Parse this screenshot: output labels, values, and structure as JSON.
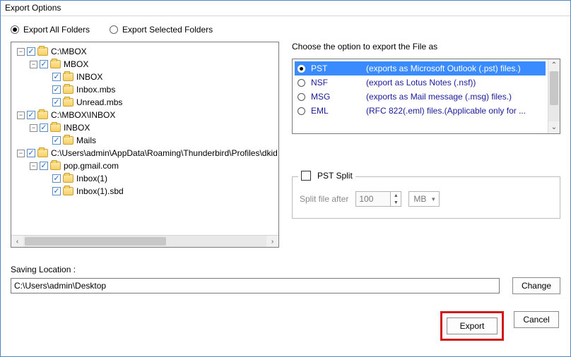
{
  "window_title": "Export Options",
  "radios": {
    "export_all": "Export All Folders",
    "export_selected": "Export Selected Folders",
    "selected": "export_all"
  },
  "tree": [
    {
      "depth": 0,
      "expander": "−",
      "checked": true,
      "label": "C:\\MBOX"
    },
    {
      "depth": 1,
      "expander": "−",
      "checked": true,
      "label": "MBOX"
    },
    {
      "depth": 2,
      "expander": "",
      "checked": true,
      "label": "INBOX"
    },
    {
      "depth": 2,
      "expander": "",
      "checked": true,
      "label": "Inbox.mbs"
    },
    {
      "depth": 2,
      "expander": "",
      "checked": true,
      "label": "Unread.mbs"
    },
    {
      "depth": 0,
      "expander": "−",
      "checked": true,
      "label": "C:\\MBOX\\INBOX"
    },
    {
      "depth": 1,
      "expander": "−",
      "checked": true,
      "label": "INBOX"
    },
    {
      "depth": 2,
      "expander": "",
      "checked": true,
      "label": "Mails"
    },
    {
      "depth": 0,
      "expander": "−",
      "checked": true,
      "label": "C:\\Users\\admin\\AppData\\Roaming\\Thunderbird\\Profiles\\dkid"
    },
    {
      "depth": 1,
      "expander": "−",
      "checked": true,
      "label": "pop.gmail.com"
    },
    {
      "depth": 2,
      "expander": "",
      "checked": true,
      "label": "Inbox(1)"
    },
    {
      "depth": 2,
      "expander": "",
      "checked": true,
      "label": "Inbox(1).sbd"
    }
  ],
  "choose_label": "Choose the option to export the File as",
  "formats": [
    {
      "name": "PST",
      "desc": "(exports as Microsoft Outlook (.pst) files.)",
      "selected": true
    },
    {
      "name": "NSF",
      "desc": "(export as Lotus Notes (.nsf))",
      "selected": false
    },
    {
      "name": "MSG",
      "desc": "(exports as Mail message (.msg) files.)",
      "selected": false
    },
    {
      "name": "EML",
      "desc": "(RFC 822(.eml) files.(Applicable only for ...",
      "selected": false
    }
  ],
  "pst_split": {
    "legend": "PST Split",
    "checked": false,
    "field_label": "Split file after",
    "value": "100",
    "unit": "MB"
  },
  "saving_location_label": "Saving Location :",
  "saving_location_value": "C:\\Users\\admin\\Desktop",
  "buttons": {
    "change": "Change",
    "export": "Export",
    "cancel": "Cancel"
  }
}
